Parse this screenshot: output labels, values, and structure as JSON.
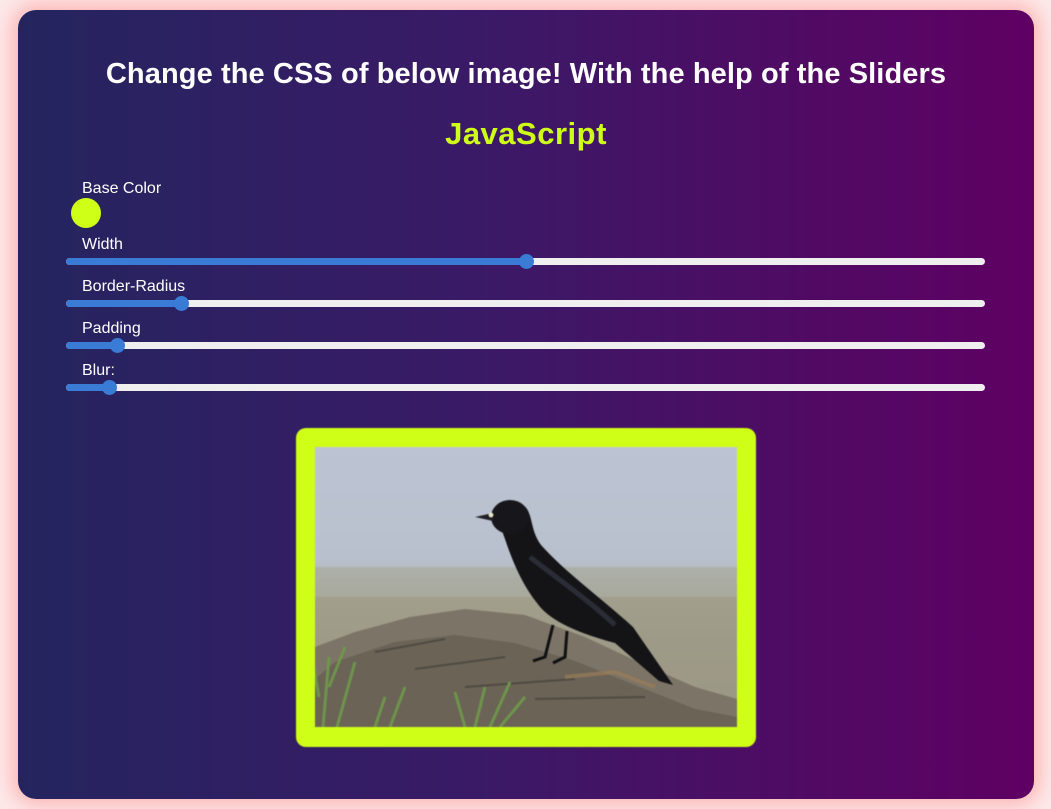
{
  "page": {
    "title": "Change the CSS of below image! With the help of the Sliders",
    "subtitle": "JavaScript"
  },
  "controls": {
    "base_color": {
      "label": "Base Color",
      "value": "#cfff17"
    },
    "width": {
      "label": "Width",
      "value_fraction": 0.5
    },
    "border_radius": {
      "label": "Border-Radius",
      "value_fraction": 0.125
    },
    "padding": {
      "label": "Padding",
      "value_fraction": 0.055
    },
    "blur": {
      "label": "Blur:",
      "value_fraction": 0.047
    }
  },
  "image": {
    "subject": "blackbird-on-rock",
    "border_color": "#cfff17"
  },
  "colors": {
    "accent": "#cfff17",
    "slider_fill": "#3a7bd5",
    "slider_track": "#efefef",
    "gradient_start": "#24255f",
    "gradient_end": "#5f0063"
  }
}
